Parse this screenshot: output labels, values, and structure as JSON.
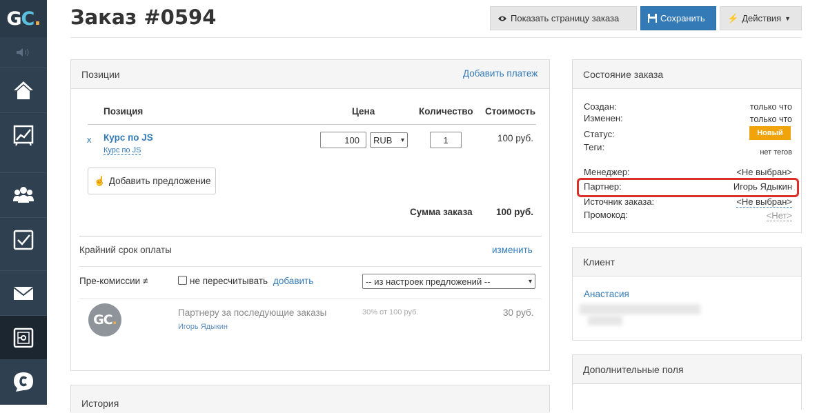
{
  "sidebar": {
    "logo": {
      "g": "G",
      "c": "C",
      "dot": "."
    },
    "items": [
      {
        "icon": "home-icon"
      },
      {
        "icon": "chart-icon"
      },
      {
        "icon": "users-icon"
      },
      {
        "icon": "tasks-icon"
      },
      {
        "icon": "mail-icon"
      },
      {
        "icon": "safe-icon"
      },
      {
        "icon": "chat-icon"
      }
    ]
  },
  "header": {
    "title": "Заказ #0594",
    "show_page": "Показать страницу заказа",
    "save": "Сохранить",
    "actions": "Действия"
  },
  "positions": {
    "title": "Позиции",
    "add_payment": "Добавить платеж",
    "columns": {
      "position": "Позиция",
      "price": "Цена",
      "quantity": "Количество",
      "cost": "Стоимость"
    },
    "row": {
      "remove": "x",
      "name": "Курс по JS",
      "sub": "Курс по JS",
      "price": "100",
      "currency": "RUB",
      "qty": "1",
      "cost": "100 руб."
    },
    "add_offer": "Добавить предложение",
    "sum_label": "Сумма заказа",
    "sum_value": "100 руб.",
    "deadline_label": "Крайний срок оплаты",
    "deadline_change": "изменить",
    "precomm_label": "Пре-комиссии",
    "precomm_sign": "≠",
    "no_recalc": "не пересчитывать",
    "add": "добавить",
    "select_value": "-- из настроек предложений --",
    "comm_title": "Партнеру за последующие заказы",
    "comm_partner": "Игорь Ядыкин",
    "comm_rate": "30% от 100 руб.",
    "comm_amount": "30 руб."
  },
  "history": {
    "title": "История"
  },
  "status": {
    "title": "Состояние заказа",
    "created_label": "Создан:",
    "created_value": "только что",
    "changed_label": "Изменен:",
    "changed_value": "только что",
    "status_label": "Статус:",
    "status_value": "Новый",
    "tags_label": "Теги:",
    "tags_value": "нет тегов",
    "manager_label": "Менеджер:",
    "manager_value": "<Не выбран>",
    "partner_label": "Партнер:",
    "partner_value": "Игорь Ядыкин",
    "source_label": "Источник заказа:",
    "source_value": "<Не выбран>",
    "promo_label": "Промокод:",
    "promo_value": "<Нет>"
  },
  "client": {
    "title": "Клиент",
    "name": "Анастасия"
  },
  "extra": {
    "title": "Дополнительные поля"
  },
  "colors": {
    "highlight": "#d9302c",
    "status_badge": "#f0a30a",
    "primary": "#337ab7"
  }
}
